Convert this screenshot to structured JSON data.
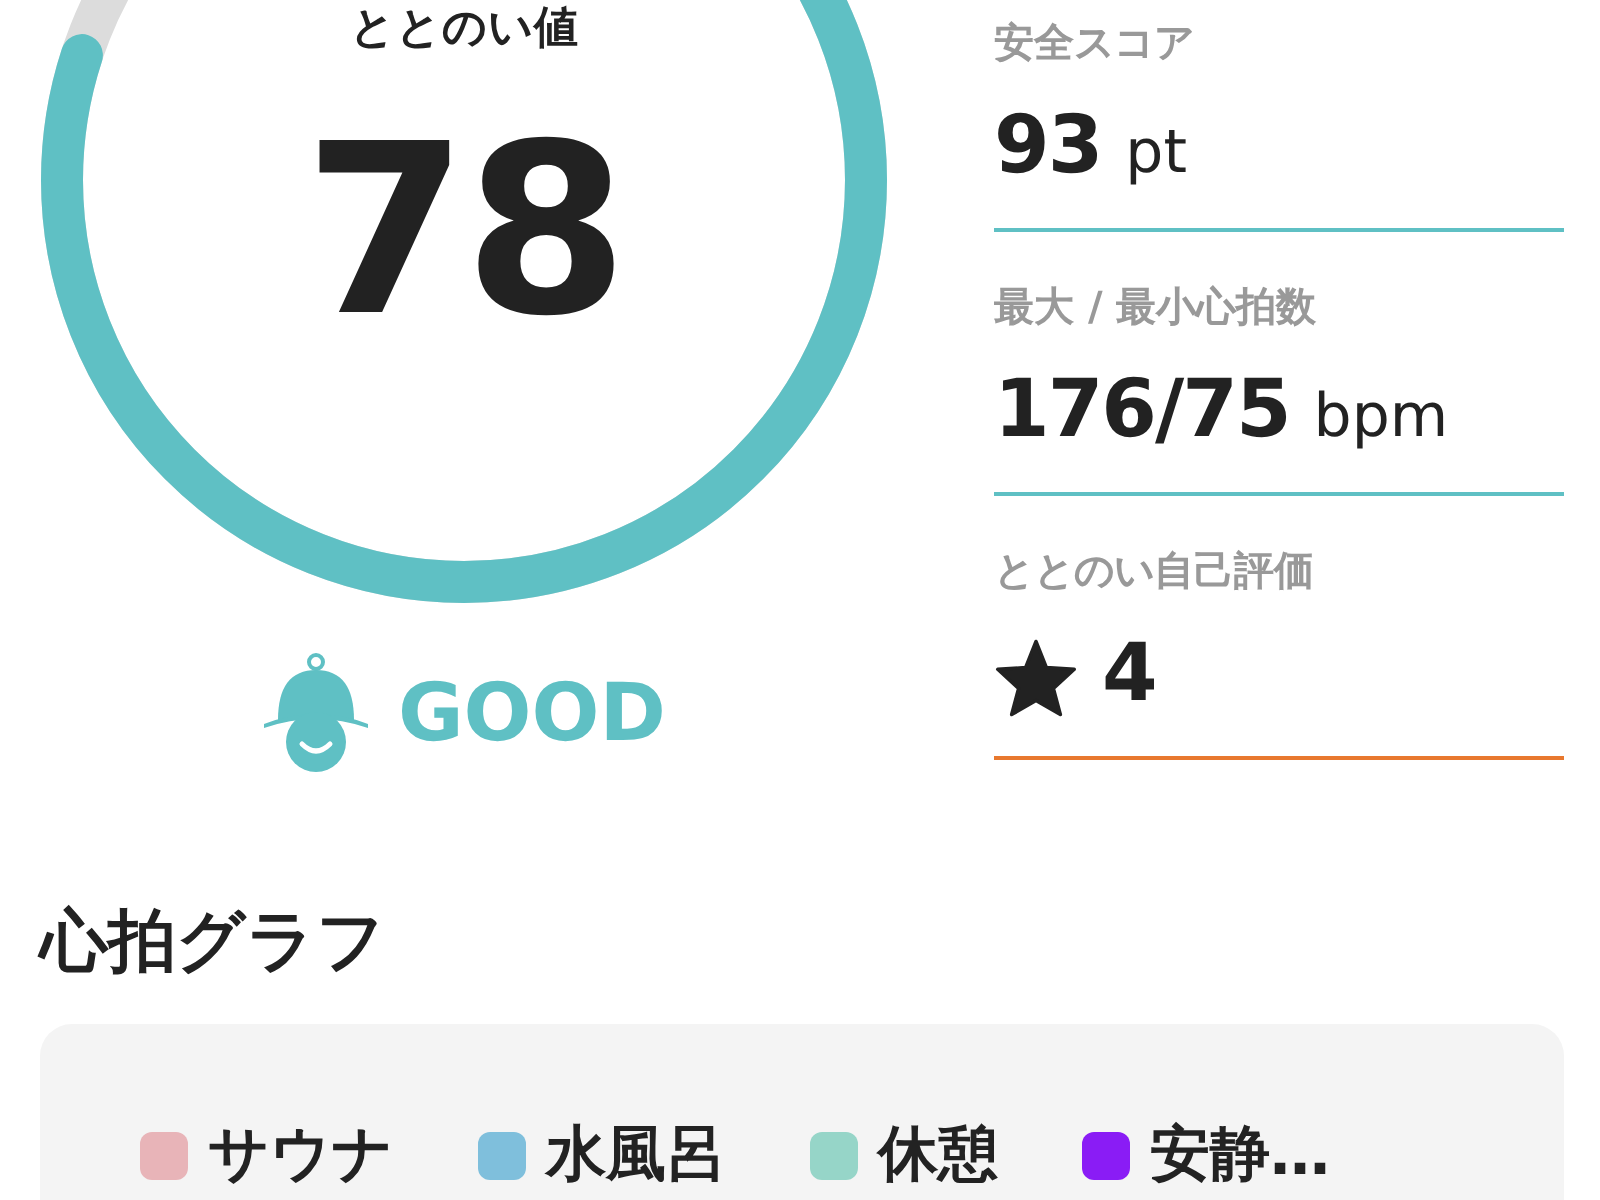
{
  "score": {
    "label": "ととのい値",
    "value": "78",
    "status": "GOOD"
  },
  "metrics": [
    {
      "label": "安全スコア",
      "value": "93",
      "unit": "pt",
      "kind": "text",
      "color": "#5fc0c4"
    },
    {
      "label": "最大 / 最小心拍数",
      "value": "176/75",
      "unit": "bpm",
      "kind": "text",
      "color": "#5fc0c4"
    },
    {
      "label": "ととのい自己評価",
      "value": "4",
      "kind": "rating",
      "color": "#e8782e"
    }
  ],
  "heart_rate_graph": {
    "title": "心拍グラフ",
    "legend": [
      {
        "label": "サウナ",
        "color": "#e8b4b8"
      },
      {
        "label": "水風呂",
        "color": "#7fbfdc"
      },
      {
        "label": "休憩",
        "color": "#96d5c8"
      },
      {
        "label": "安静…",
        "color": "#8a1cf5"
      }
    ]
  }
}
